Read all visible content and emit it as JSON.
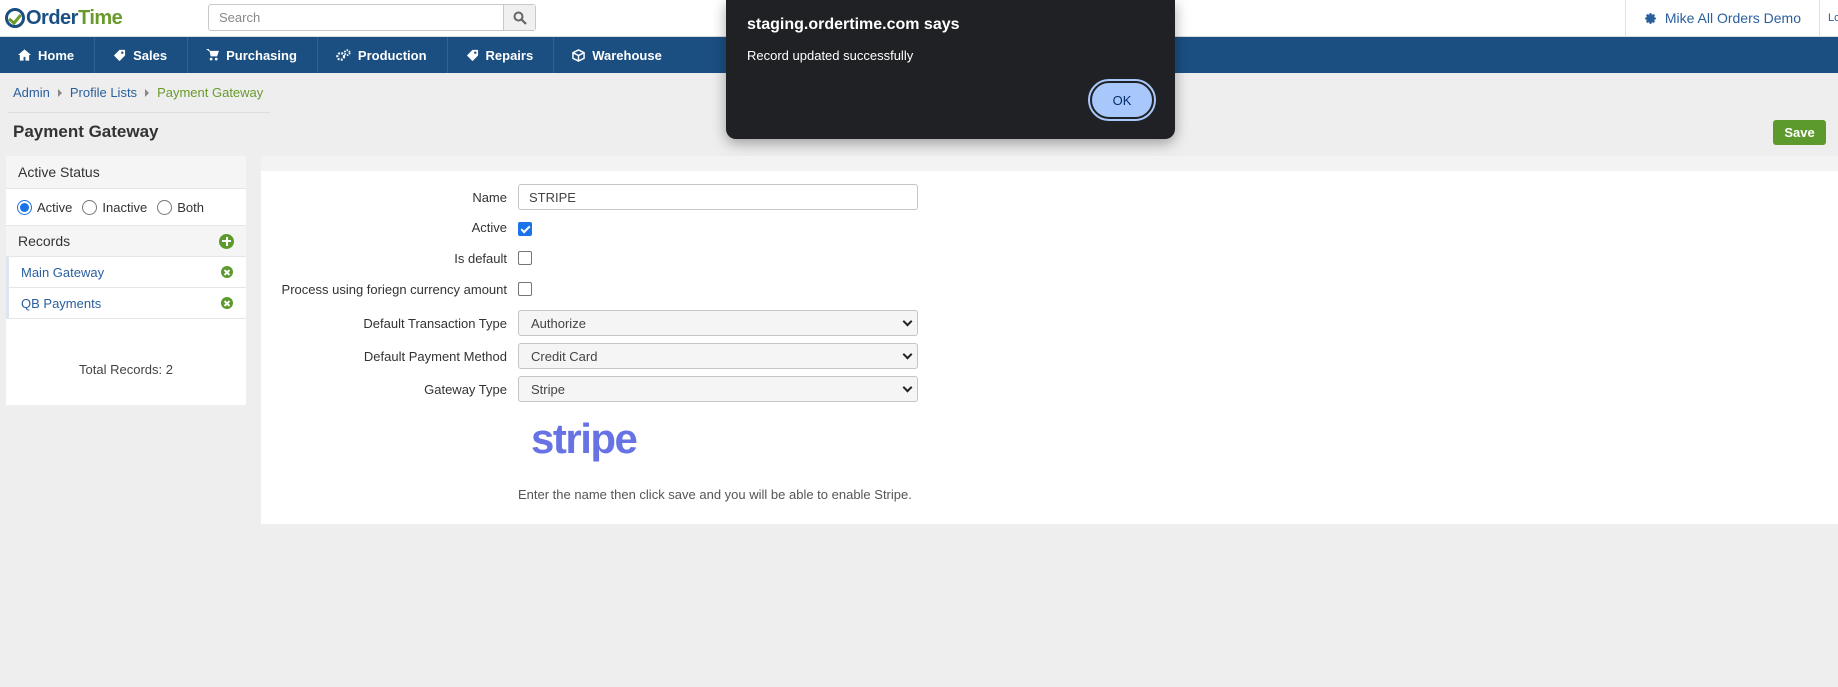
{
  "app": {
    "logo_part1": "Order",
    "logo_part2": "Time"
  },
  "search": {
    "placeholder": "Search"
  },
  "user": {
    "name": "Mike All Orders Demo",
    "logout": "Logout"
  },
  "nav": {
    "items": [
      {
        "label": "Home",
        "icon": "home-icon"
      },
      {
        "label": "Sales",
        "icon": "tag-icon"
      },
      {
        "label": "Purchasing",
        "icon": "cart-icon"
      },
      {
        "label": "Production",
        "icon": "cogs-icon"
      },
      {
        "label": "Repairs",
        "icon": "wrench-icon"
      },
      {
        "label": "Warehouse",
        "icon": "box-icon"
      }
    ]
  },
  "breadcrumb": {
    "admin": "Admin",
    "profile_lists": "Profile Lists",
    "current": "Payment Gateway"
  },
  "page": {
    "title": "Payment Gateway",
    "save_label": "Save"
  },
  "sidebar": {
    "active_status_title": "Active Status",
    "status_options": [
      "Active",
      "Inactive",
      "Both"
    ],
    "selected_status": "Active",
    "records_title": "Records",
    "records": [
      "Main Gateway",
      "QB Payments"
    ],
    "total_records": "Total Records: 2"
  },
  "form": {
    "name_label": "Name",
    "name_value": "STRIPE",
    "active_label": "Active",
    "active_checked": true,
    "is_default_label": "Is default",
    "is_default_checked": false,
    "foreign_label": "Process using foriegn currency amount",
    "foreign_checked": false,
    "txn_type_label": "Default Transaction Type",
    "txn_type_value": "Authorize",
    "pay_method_label": "Default Payment Method",
    "pay_method_value": "Credit Card",
    "gateway_type_label": "Gateway Type",
    "gateway_type_value": "Stripe",
    "gateway_logo_text": "stripe",
    "hint": "Enter the name then click save and you will be able to enable Stripe."
  },
  "dialog": {
    "title": "staging.ordertime.com says",
    "message": "Record updated successfully",
    "ok_label": "OK"
  },
  "colors": {
    "nav": "#1b4f82",
    "accent_green": "#5d9a2e",
    "link": "#2a5f9e",
    "stripe": "#6772e5"
  }
}
